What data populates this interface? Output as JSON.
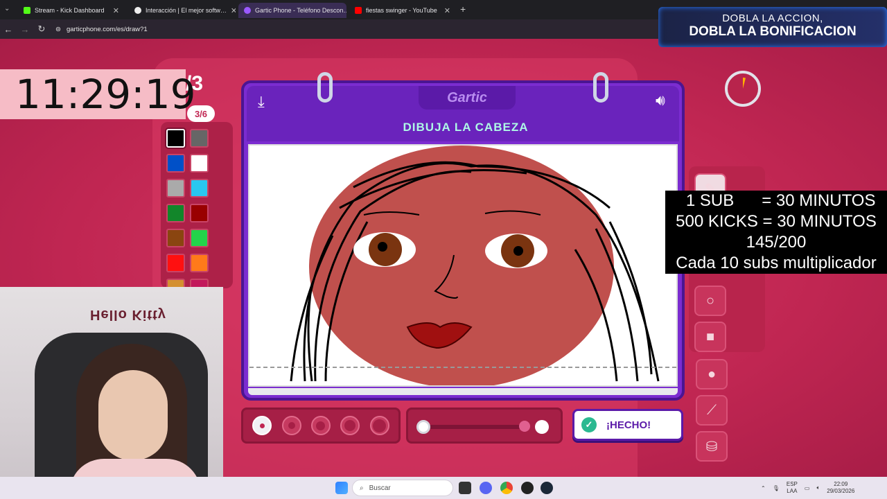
{
  "browser": {
    "tabs": [
      {
        "label": "Stream - Kick Dashboard",
        "color": "#53fc18"
      },
      {
        "label": "Interacción | El mejor softw…",
        "color": "#ffffff"
      },
      {
        "label": "Gartic Phone - Teléfono Descon…",
        "color": "#9b59ff"
      },
      {
        "label": "fiestas swinger - YouTube",
        "color": "#ff0000"
      }
    ],
    "url": "garticphone.com/es/draw?1"
  },
  "overlay": {
    "promo_line1": "DOBLA LA ACCION,",
    "promo_line2": "DOBLA LA BONIFICACION",
    "clock": "11:29:19",
    "round_big": "/3",
    "round_small": "3/6",
    "sub_info": {
      "line1": "  1 SUB      = 30 MINUTOS",
      "line2": "500 KICKS = 30 MINUTOS",
      "line3": "145/200",
      "line4": "Cada 10 subs multiplicador"
    },
    "webcam_wall_text": "Hello Kitty"
  },
  "game": {
    "logo": "Gartic",
    "instruction": "DIBUJA LA CABEZA",
    "done_label": "¡HECHO!",
    "palette": [
      "#000000",
      "#666666",
      "#0050c8",
      "#ffffff",
      "#aaaaaa",
      "#29c7f0",
      "#12862a",
      "#990000",
      "#8a4510",
      "#23d44a",
      "#ff1010",
      "#ff7a1a",
      "#d49030",
      "#c2185b"
    ],
    "selected_color": "#000000",
    "brush_sizes": [
      1,
      2,
      3,
      4,
      5
    ],
    "selected_size": 1,
    "opacity": 0.0
  },
  "taskbar": {
    "search_placeholder": "Buscar",
    "lang1": "ESP",
    "lang2": "LAA",
    "time": "22:09",
    "date": "29/03/2026"
  }
}
